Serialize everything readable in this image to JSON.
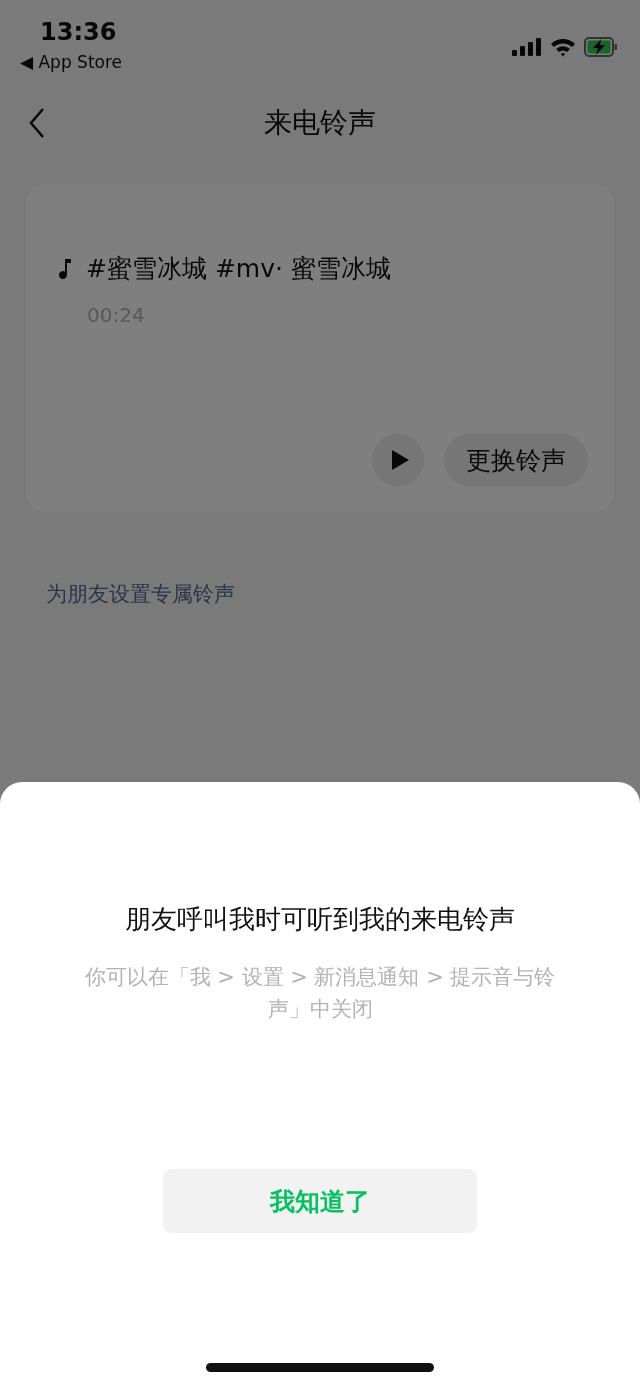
{
  "status_bar": {
    "time": "13:36",
    "back_app": "◀ App Store"
  },
  "nav": {
    "title": "来电铃声"
  },
  "ringtone": {
    "title": "#蜜雪冰城 #mv· 蜜雪冰城",
    "duration": "00:24",
    "change_button": "更换铃声"
  },
  "friend_link": "为朋友设置专属铃声",
  "sheet": {
    "title": "朋友呼叫我时可听到我的来电铃声",
    "message": "你可以在「我 > 设置 > 新消息通知 > 提示音与铃声」中关闭",
    "button": "我知道了"
  }
}
